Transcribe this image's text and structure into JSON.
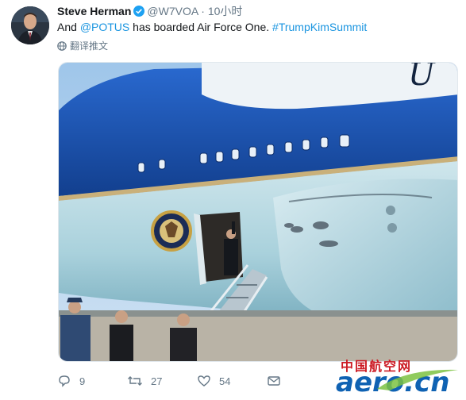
{
  "tweet": {
    "author_name": "Steve Herman",
    "handle": "@W7VOA",
    "separator": "·",
    "time": "10小时",
    "text_prefix": "And ",
    "mention": "@POTUS",
    "text_middle": " has boarded Air Force One. ",
    "hashtag": "#TrumpKimSummit",
    "translate_label": "翻译推文"
  },
  "actions": {
    "reply_count": "9",
    "retweet_count": "27",
    "like_count": "54"
  },
  "watermark": {
    "cn": "中国航空网",
    "en": "aero.cn"
  },
  "colors": {
    "link": "#1b95e0",
    "verified": "#1da1f2",
    "plane_blue": "#1a4fa3",
    "muted": "#657786"
  },
  "icons": [
    "verified-badge-icon",
    "globe-icon",
    "reply-icon",
    "retweet-icon",
    "like-icon",
    "dm-icon"
  ]
}
